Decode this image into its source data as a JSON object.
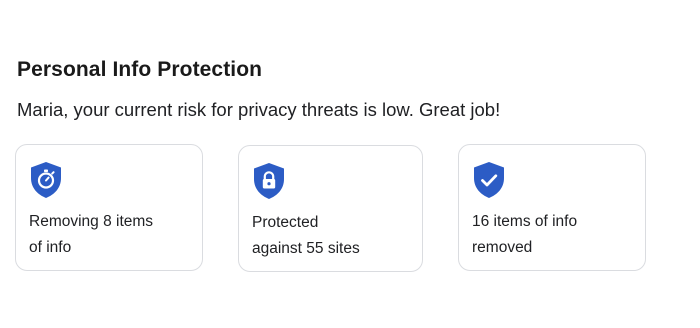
{
  "header": {
    "title": "Personal Info Protection",
    "subtitle": "Maria, your current risk for privacy threats is low. Great job!"
  },
  "cards": [
    {
      "icon": "shield-timer-icon",
      "line1": "Removing 8 items",
      "line2": "of info"
    },
    {
      "icon": "shield-lock-icon",
      "line1": "Protected",
      "line2": "against 55 sites"
    },
    {
      "icon": "shield-check-icon",
      "line1": "16 items of info",
      "line2": "removed"
    }
  ],
  "colors": {
    "shield": "#2c5cc5",
    "border": "#dadce0",
    "text": "#202124"
  }
}
